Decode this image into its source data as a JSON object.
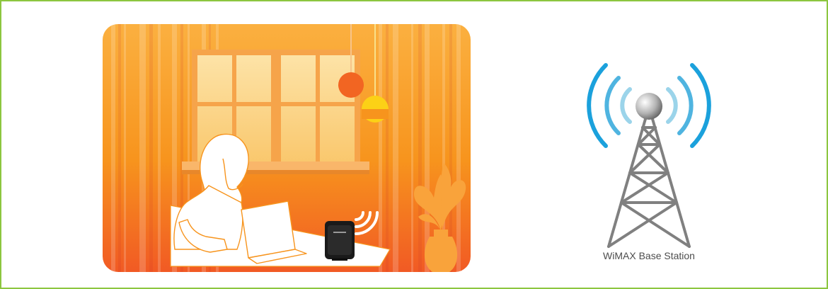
{
  "caption": "WiMAX Base Station",
  "colors": {
    "frame_border": "#8cc63f",
    "scene_orange_light": "#fbb040",
    "scene_orange_dark": "#f15a24",
    "wave_outer": "#1ba1dc",
    "wave_inner": "#9bd4ea",
    "tower_gray": "#808080"
  },
  "icons": {
    "woman": "woman-at-laptop-icon",
    "laptop": "laptop-icon",
    "router": "wimax-router-icon",
    "router_signal": "wifi-signal-icon",
    "lamp": "pendant-lamp-icon",
    "plant": "potted-plant-icon",
    "tower": "radio-tower-icon",
    "tower_waves": "broadcast-waves-icon"
  }
}
